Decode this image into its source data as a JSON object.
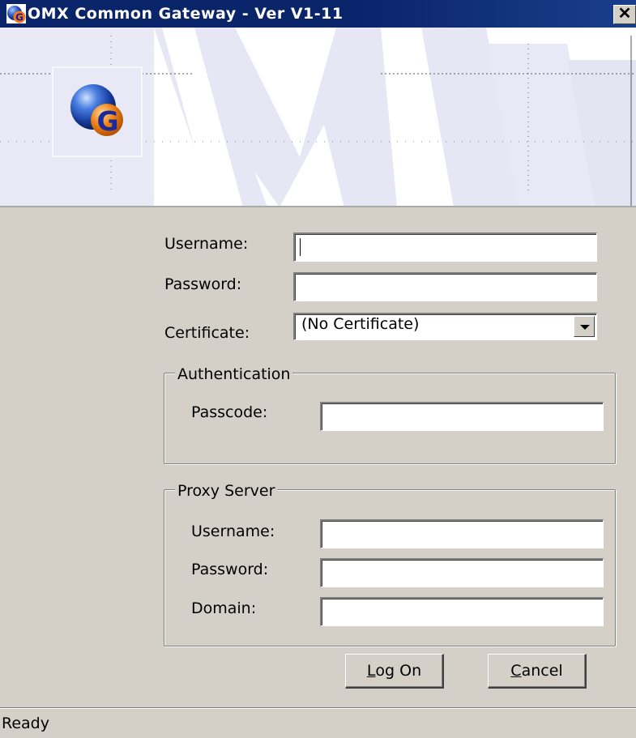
{
  "window": {
    "title": "OMX Common Gateway - Ver V1-11",
    "close_label": "✕"
  },
  "colors": {
    "titlebar": "#0a246a",
    "banner_watermark": "#e6e6f5",
    "dialog_bg": "#d4d0c8"
  },
  "icons": {
    "app": "omx-logo-icon",
    "close": "close-icon",
    "dropdown": "chevron-down-icon"
  },
  "login": {
    "username_label": "Username:",
    "username_value": "",
    "password_label": "Password:",
    "password_value": "",
    "certificate_label": "Certificate:",
    "certificate_selected": "(No Certificate)"
  },
  "authentication": {
    "title": "Authentication",
    "passcode_label": "Passcode:",
    "passcode_value": ""
  },
  "proxy": {
    "title": "Proxy Server",
    "username_label": "Username:",
    "username_value": "",
    "password_label": "Password:",
    "password_value": "",
    "domain_label": "Domain:",
    "domain_value": ""
  },
  "buttons": {
    "logon_mnemonic": "L",
    "logon_rest": "og On",
    "cancel_mnemonic": "C",
    "cancel_rest": "ancel"
  },
  "status": {
    "text": "Ready"
  }
}
